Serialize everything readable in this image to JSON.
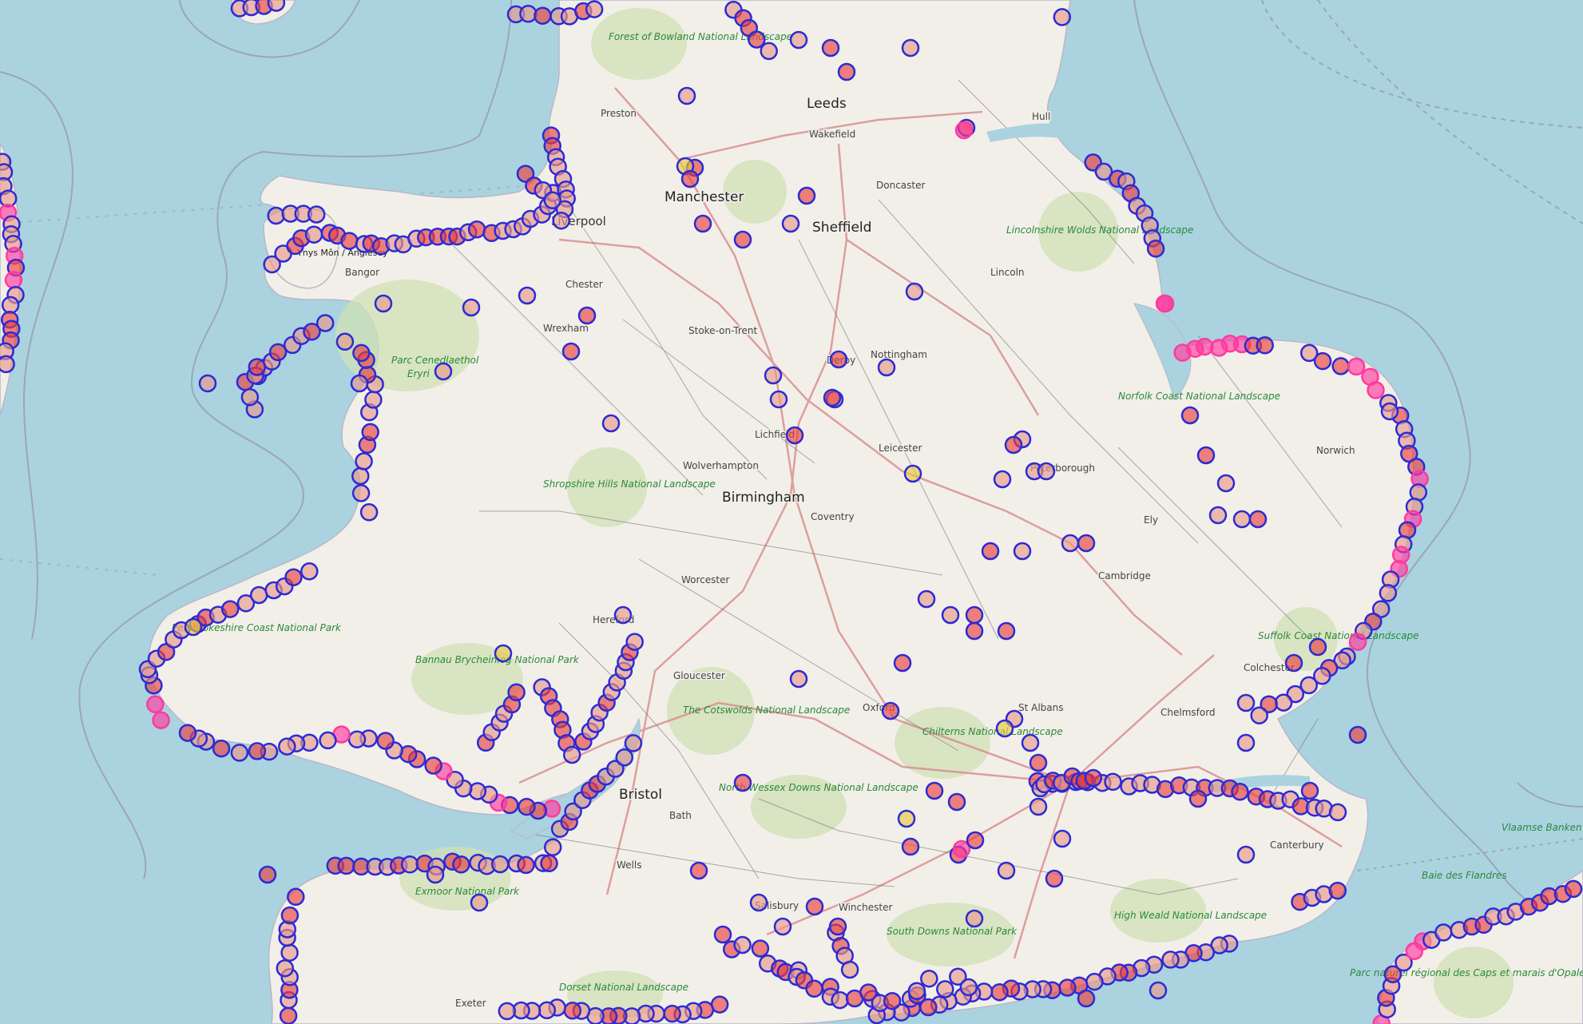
{
  "map": {
    "colors": {
      "sea": "#aad3df",
      "land": "#f2efe9",
      "park": "#c8dcae",
      "dot_blue": "#2b2bd6",
      "dot_red": "#e84040",
      "dot_salmon": "#e89a8a",
      "dot_pink": "#ff3aa0",
      "dot_yellow": "#e8c840",
      "motorway": "#d88a8a",
      "road": "#666666",
      "boundary": "#8a8aa0"
    },
    "cities": [
      {
        "name": "Manchester",
        "size": "big"
      },
      {
        "name": "Birmingham",
        "size": "big"
      },
      {
        "name": "Sheffield",
        "size": "big"
      },
      {
        "name": "Bristol",
        "size": "big"
      },
      {
        "name": "Leeds",
        "size": "big"
      },
      {
        "name": "Preston",
        "size": "town"
      },
      {
        "name": "Wakefield",
        "size": "town"
      },
      {
        "name": "Doncaster",
        "size": "town"
      },
      {
        "name": "Hull",
        "size": "town"
      },
      {
        "name": "Lincoln",
        "size": "town"
      },
      {
        "name": "Chester",
        "size": "town"
      },
      {
        "name": "Wrexham",
        "size": "town"
      },
      {
        "name": "Stoke-on-Trent",
        "size": "town"
      },
      {
        "name": "Derby",
        "size": "town"
      },
      {
        "name": "Nottingham",
        "size": "town"
      },
      {
        "name": "Lichfield",
        "size": "town"
      },
      {
        "name": "Leicester",
        "size": "town"
      },
      {
        "name": "Wolverhampton",
        "size": "town"
      },
      {
        "name": "Coventry",
        "size": "town"
      },
      {
        "name": "Peterborough",
        "size": "town"
      },
      {
        "name": "Norwich",
        "size": "town"
      },
      {
        "name": "Ely",
        "size": "town"
      },
      {
        "name": "Cambridge",
        "size": "town"
      },
      {
        "name": "Worcester",
        "size": "town"
      },
      {
        "name": "Hereford",
        "size": "town"
      },
      {
        "name": "Gloucester",
        "size": "town"
      },
      {
        "name": "Colchester",
        "size": "town"
      },
      {
        "name": "Chelmsford",
        "size": "town"
      },
      {
        "name": "Oxford",
        "size": "town"
      },
      {
        "name": "St Albans",
        "size": "town"
      },
      {
        "name": "Bath",
        "size": "town"
      },
      {
        "name": "Wells",
        "size": "town"
      },
      {
        "name": "Salisbury",
        "size": "town"
      },
      {
        "name": "Winchester",
        "size": "town"
      },
      {
        "name": "Canterbury",
        "size": "town"
      },
      {
        "name": "Exeter",
        "size": "town"
      },
      {
        "name": "Bangor",
        "size": "town"
      },
      {
        "name": "Liverpool",
        "size": "big"
      }
    ],
    "parks": [
      {
        "name": "Forest of Bowland National Landscape"
      },
      {
        "name": "Lincolnshire Wolds National Landscape"
      },
      {
        "name": "Eryri",
        "prefix": "Parc Cenedlaethol"
      },
      {
        "name": "Shropshire Hills National Landscape"
      },
      {
        "name": "Norfolk Coast National Landscape"
      },
      {
        "name": "Bannau Brycheiniog National Park"
      },
      {
        "name": "Pembrokeshire Coast National Park"
      },
      {
        "name": "The Cotswolds National Landscape"
      },
      {
        "name": "Chilterns National Landscape"
      },
      {
        "name": "Suffolk Coast National Landscape"
      },
      {
        "name": "North Wessex Downs National Landscape"
      },
      {
        "name": "Exmoor National Park"
      },
      {
        "name": "South Downs National Park"
      },
      {
        "name": "High Weald National Landscape"
      },
      {
        "name": "Dorset National Landscape"
      },
      {
        "name": "Baie des Flandres"
      },
      {
        "name": "Parc naturel régional des Caps et marais d'Opale"
      },
      {
        "name": "Vlaamse Banken"
      }
    ],
    "islands": [
      {
        "name": "Ynys Môn / Anglesey"
      }
    ]
  }
}
